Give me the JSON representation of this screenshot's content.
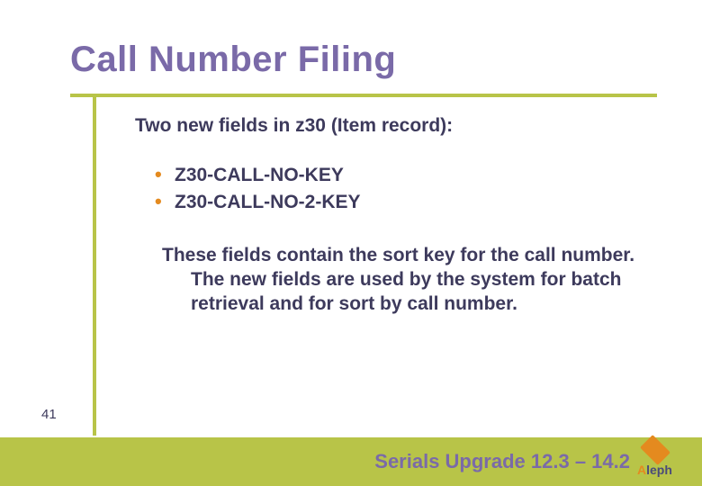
{
  "title": "Call Number Filing",
  "subtitle": "Two new fields in z30 (Item record):",
  "bullets": [
    "Z30-CALL-NO-KEY",
    "Z30-CALL-NO-2-KEY"
  ],
  "description": "These fields contain the sort key for the call number. The new fields are used by the system for batch retrieval and for sort by call number.",
  "slide_number": "41",
  "footer": "Serials Upgrade 12.3 – 14.2",
  "logo_text_a": "A",
  "logo_text_rest": "leph"
}
